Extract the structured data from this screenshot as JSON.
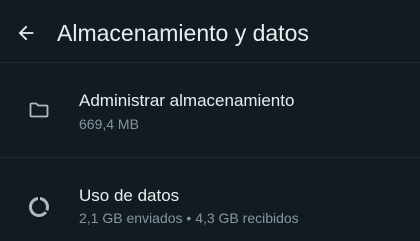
{
  "appbar": {
    "title": "Almacenamiento y datos",
    "back_icon": "arrow-left-icon"
  },
  "items": [
    {
      "icon": "folder-icon",
      "title": "Administrar almacenamiento",
      "subtitle": "669,4 MB"
    },
    {
      "icon": "data-usage-icon",
      "title": "Uso de datos",
      "subtitle": "2,1 GB enviados • 4,3 GB recibidos"
    }
  ],
  "colors": {
    "background": "#121b22",
    "primary_text": "#e9edef",
    "secondary_text": "#8696a0",
    "divider": "#1f2c34",
    "icon": "#aebac1"
  }
}
